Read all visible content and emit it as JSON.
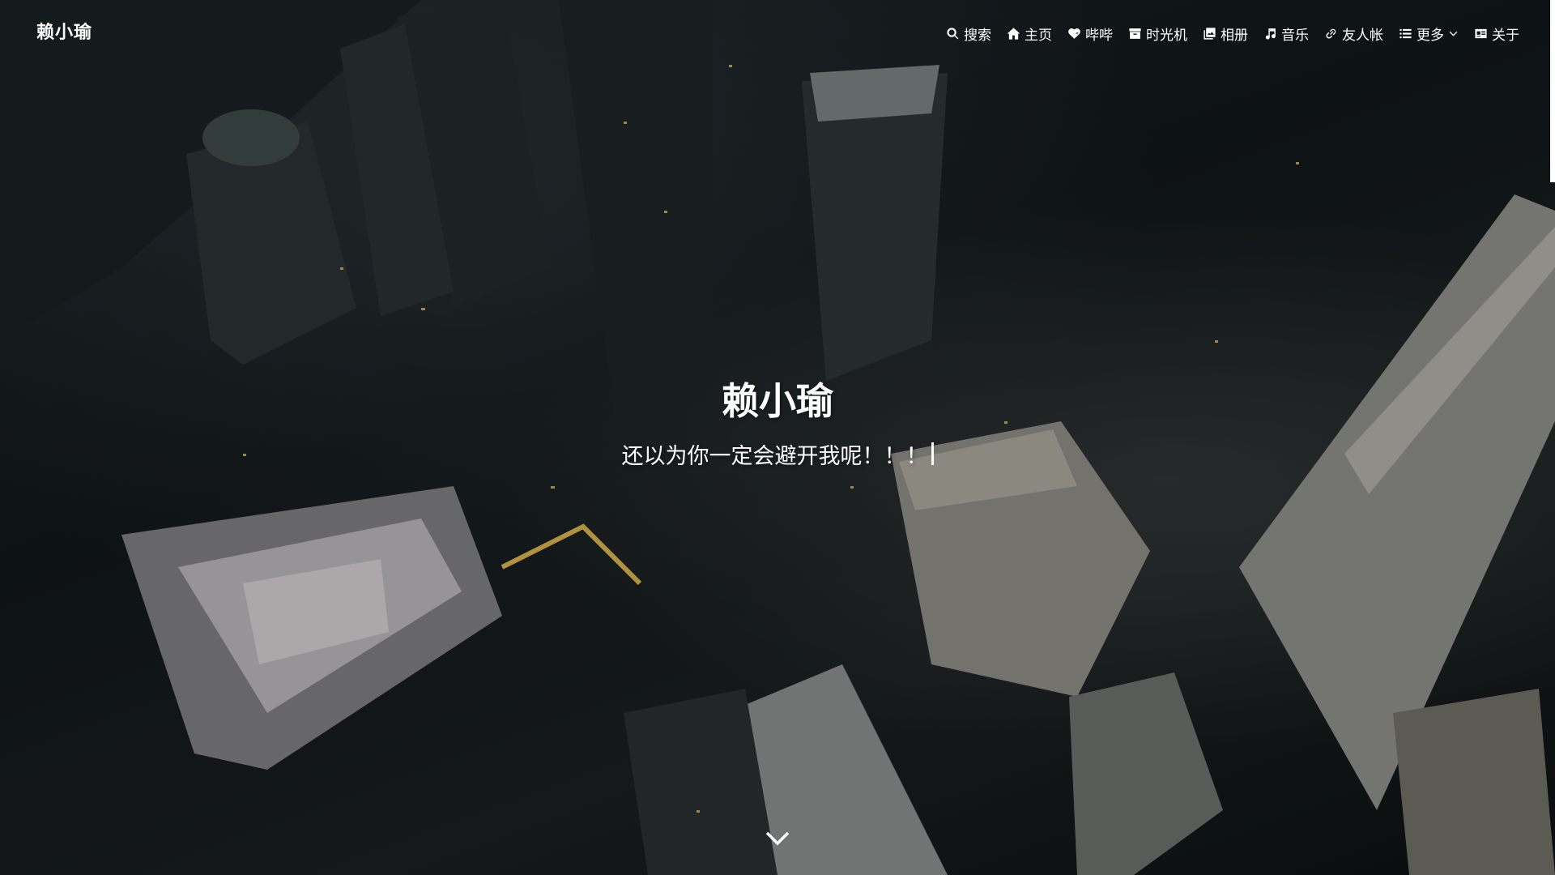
{
  "site": {
    "name": "赖小瑜",
    "title": "赖小瑜",
    "subtitle": "还以为你一定会避开我呢！！！"
  },
  "nav": {
    "items": [
      {
        "label": "搜索",
        "icon": "search-icon"
      },
      {
        "label": "主页",
        "icon": "home-icon"
      },
      {
        "label": "哔哔",
        "icon": "heartbeat-icon"
      },
      {
        "label": "时光机",
        "icon": "archive-box-icon"
      },
      {
        "label": "相册",
        "icon": "images-icon"
      },
      {
        "label": "音乐",
        "icon": "music-note-icon"
      },
      {
        "label": "友人帐",
        "icon": "link-icon"
      },
      {
        "label": "更多",
        "icon": "list-icon"
      },
      {
        "label": "关于",
        "icon": "id-card-icon"
      }
    ]
  },
  "colors": {
    "text": "#ffffff",
    "background": "#111719"
  },
  "icons": {
    "scroll": "chevron-down-icon"
  }
}
